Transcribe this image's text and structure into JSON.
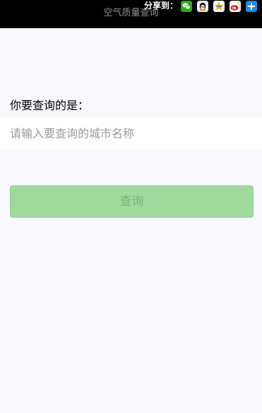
{
  "header": {
    "title": "空气质量查询",
    "share_label": "分享到：",
    "share_targets": [
      {
        "icon": "wechat-icon",
        "color": "#2aae17"
      },
      {
        "icon": "qq-icon",
        "color": "#1a6fd0"
      },
      {
        "icon": "qzone-icon",
        "color": "#f4b400"
      },
      {
        "icon": "weibo-icon",
        "color": "#e6162d"
      },
      {
        "icon": "more-share-icon",
        "color": "#1c8fe0"
      }
    ]
  },
  "form": {
    "prompt": "你要查询的是：",
    "city_placeholder": "请输入要查询的城市名称",
    "city_value": "",
    "submit_label": "查询"
  },
  "colors": {
    "page_background": "#f9f8fd",
    "topbar_background": "#000000",
    "button_background": "#9fd99e",
    "button_text": "#7bb27c"
  }
}
